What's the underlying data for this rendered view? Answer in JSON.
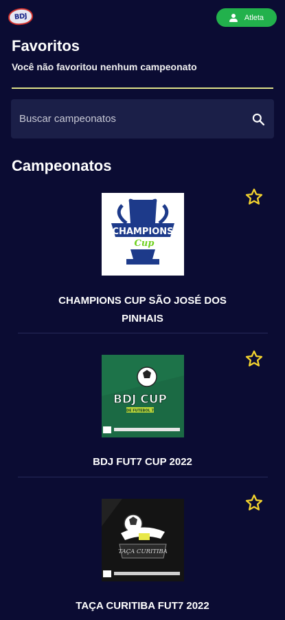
{
  "header": {
    "logo_text": "BDJ",
    "athlete_label": "Atleta"
  },
  "favorites": {
    "title": "Favoritos",
    "empty_message": "Você não favoritou nenhum campeonato"
  },
  "search": {
    "placeholder": "Buscar campeonatos"
  },
  "championships": {
    "title": "Campeonatos",
    "items": [
      {
        "name": "CHAMPIONS CUP SÃO JOSÉ DOS PINHAIS",
        "logo_text": "CHAMPIONS",
        "logo_sub": "Cup"
      },
      {
        "name": "BDJ FUT7 CUP 2022",
        "logo_text": "BDJ CUP",
        "logo_sub": "DE FUTEBOL 7"
      },
      {
        "name": "TAÇA CURITIBA FUT7 2022",
        "logo_text": "TAÇA CURITIBA",
        "logo_sub": ""
      }
    ]
  },
  "colors": {
    "background": "#0b0c33",
    "accent_green": "#22b14c",
    "star_yellow": "#f2d22e",
    "divider_yellow": "#dfe28a"
  }
}
